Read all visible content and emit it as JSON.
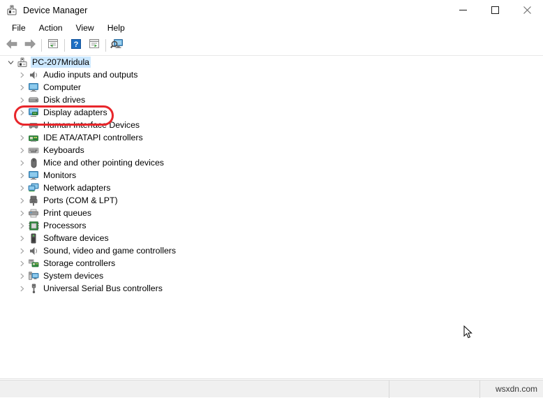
{
  "window": {
    "title": "Device Manager",
    "icon": "device-manager-icon",
    "controls": {
      "minimize": "–",
      "maximize": "□",
      "close": "✕"
    }
  },
  "menubar": {
    "items": [
      {
        "label": "File"
      },
      {
        "label": "Action"
      },
      {
        "label": "View"
      },
      {
        "label": "Help"
      }
    ]
  },
  "toolbar": {
    "buttons": [
      {
        "name": "back-button",
        "icon": "back-arrow-icon"
      },
      {
        "name": "forward-button",
        "icon": "forward-arrow-icon"
      },
      {
        "name": "properties-button",
        "icon": "properties-icon"
      },
      {
        "name": "help-button",
        "icon": "help-question-icon"
      },
      {
        "name": "update-driver-button",
        "icon": "update-driver-icon"
      },
      {
        "name": "scan-hardware-changes-button",
        "icon": "scan-hardware-icon"
      }
    ]
  },
  "tree": {
    "root": {
      "label": "PC-207Mridula",
      "icon": "computer-root-icon",
      "expanded": true,
      "selected": true
    },
    "items": [
      {
        "label": "Audio inputs and outputs",
        "icon": "speaker-icon",
        "expanded": false
      },
      {
        "label": "Computer",
        "icon": "monitor-icon",
        "expanded": false
      },
      {
        "label": "Disk drives",
        "icon": "disk-drive-icon",
        "expanded": false
      },
      {
        "label": "Display adapters",
        "icon": "display-adapter-icon",
        "expanded": false,
        "highlighted": true
      },
      {
        "label": "Human Interface Devices",
        "icon": "hid-icon",
        "expanded": false
      },
      {
        "label": "IDE ATA/ATAPI controllers",
        "icon": "ide-controller-icon",
        "expanded": false
      },
      {
        "label": "Keyboards",
        "icon": "keyboard-icon",
        "expanded": false
      },
      {
        "label": "Mice and other pointing devices",
        "icon": "mouse-icon",
        "expanded": false
      },
      {
        "label": "Monitors",
        "icon": "monitor-icon",
        "expanded": false
      },
      {
        "label": "Network adapters",
        "icon": "network-adapter-icon",
        "expanded": false
      },
      {
        "label": "Ports (COM & LPT)",
        "icon": "port-connector-icon",
        "expanded": false
      },
      {
        "label": "Print queues",
        "icon": "printer-icon",
        "expanded": false
      },
      {
        "label": "Processors",
        "icon": "processor-chip-icon",
        "expanded": false
      },
      {
        "label": "Software devices",
        "icon": "software-device-icon",
        "expanded": false
      },
      {
        "label": "Sound, video and game controllers",
        "icon": "speaker-icon",
        "expanded": false
      },
      {
        "label": "Storage controllers",
        "icon": "storage-controller-icon",
        "expanded": false
      },
      {
        "label": "System devices",
        "icon": "system-device-icon",
        "expanded": false
      },
      {
        "label": "Universal Serial Bus controllers",
        "icon": "usb-icon",
        "expanded": false
      }
    ]
  },
  "annotation": {
    "highlight_target": "Display adapters",
    "highlight_color": "#e8262b",
    "shape": "oval"
  },
  "statusbar": {
    "left_text": "",
    "middle_text": "",
    "watermark": "wsxdn.com"
  },
  "colors": {
    "selection": "#cce8ff",
    "annotation_red": "#e8262b",
    "statusbar_bg": "#f0f0f0",
    "window_bg": "#ffffff"
  }
}
